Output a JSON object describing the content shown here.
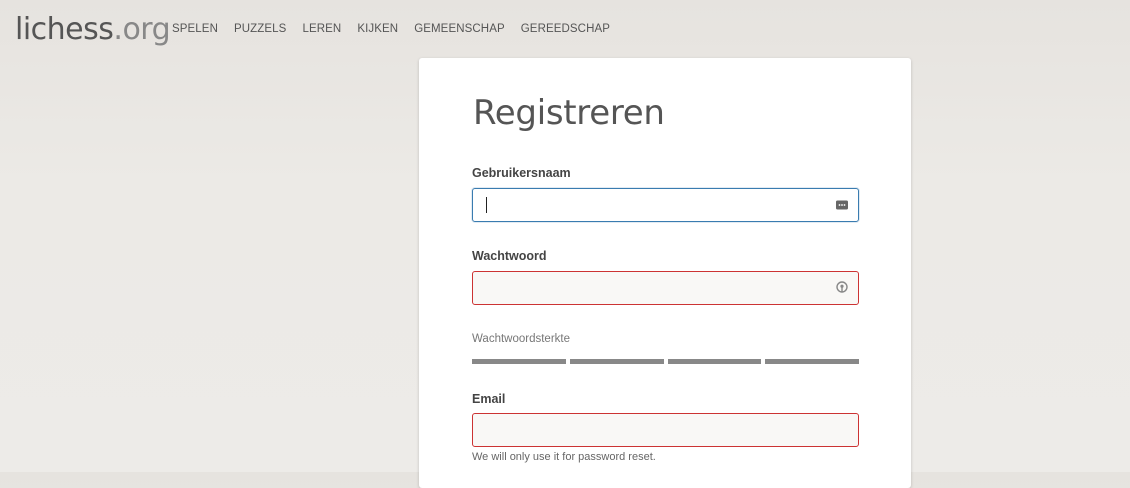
{
  "header": {
    "logo_main": "lichess",
    "logo_tld": ".org",
    "nav": [
      {
        "label": "SPELEN"
      },
      {
        "label": "PUZZELS"
      },
      {
        "label": "LEREN"
      },
      {
        "label": "KIJKEN"
      },
      {
        "label": "GEMEENSCHAP"
      },
      {
        "label": "GEREEDSCHAP"
      }
    ]
  },
  "form": {
    "title": "Registreren",
    "username": {
      "label": "Gebruikersnaam",
      "value": "",
      "icon": "password-manager-icon"
    },
    "password": {
      "label": "Wachtwoord",
      "value": "",
      "icon": "password-key-icon"
    },
    "strength": {
      "label": "Wachtwoordsterkte",
      "segments": 4
    },
    "email": {
      "label": "Email",
      "value": "",
      "help": "We will only use it for password reset."
    }
  },
  "colors": {
    "focus_border": "#3a7cb0",
    "invalid_border": "#cc3333",
    "meter": "#888888"
  }
}
